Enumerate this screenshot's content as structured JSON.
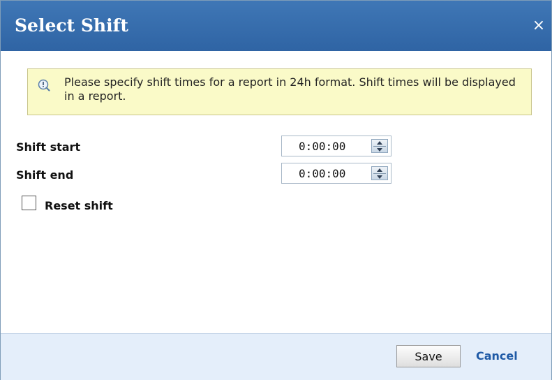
{
  "dialog": {
    "title": "Select Shift",
    "close_glyph": "×"
  },
  "notice": {
    "icon": "info-magnifier-icon",
    "text": "Please specify shift times for a report in 24h format. Shift times will be displayed in a report."
  },
  "fields": {
    "shift_start": {
      "label": "Shift start",
      "value": "0:00:00"
    },
    "shift_end": {
      "label": "Shift end",
      "value": "0:00:00"
    }
  },
  "reset": {
    "label": "Reset shift",
    "checked": false
  },
  "footer": {
    "save_label": "Save",
    "cancel_label": "Cancel"
  },
  "colors": {
    "titlebar": "#3569ab",
    "notice_bg": "#fafac8",
    "footer_bg": "#e4eefa",
    "link": "#1f5aa6"
  }
}
